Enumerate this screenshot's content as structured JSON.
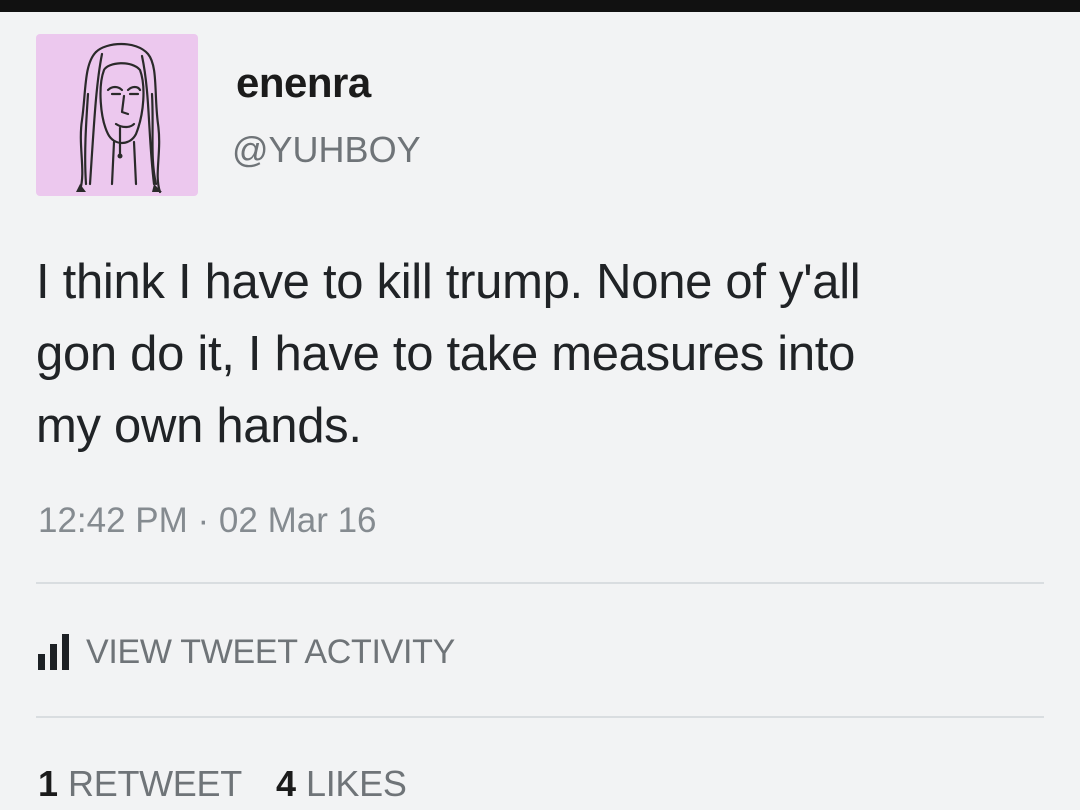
{
  "tweet": {
    "display_name": "enenra",
    "handle": "@YUHBOY",
    "text_lines": [
      "I think I have to kill trump. None of y'all",
      "gon do it, I have to take measures into",
      "my own hands."
    ],
    "timestamp": "12:42 PM · 02 Mar 16",
    "activity_label": "VIEW TWEET ACTIVITY",
    "retweets": {
      "count": "1",
      "label": "RETWEET"
    },
    "likes": {
      "count": "4",
      "label": "LIKES"
    }
  },
  "icons": {
    "avatar": "drawn-portrait-avatar",
    "activity": "bar-chart-icon"
  },
  "colors": {
    "avatar_bg": "#ecc8ee",
    "background": "#f2f3f4",
    "top_bar": "#111111"
  }
}
